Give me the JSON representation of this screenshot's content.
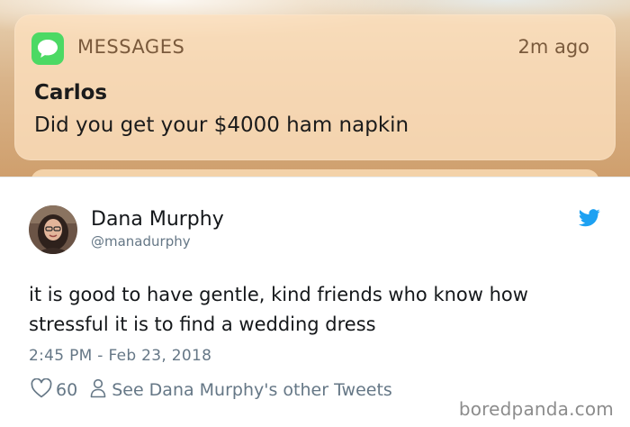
{
  "notification": {
    "app_name": "MESSAGES",
    "time": "2m ago",
    "sender": "Carlos",
    "message": "Did you get your $4000 ham napkin",
    "app_icon": "speech-bubble-icon",
    "accent_color": "#4cd964"
  },
  "tweet": {
    "author_name": "Dana Murphy",
    "handle": "@manadurphy",
    "text": "it is good to have gentle, kind friends who know how stressful it is to find a wedding dress",
    "timestamp": "2:45 PM - Feb 23, 2018",
    "like_count": "60",
    "profile_link": "See Dana Murphy's other Tweets",
    "brand_icon": "twitter-bird-icon",
    "brand_color": "#1da1f2"
  },
  "watermark": "boredpanda.com"
}
